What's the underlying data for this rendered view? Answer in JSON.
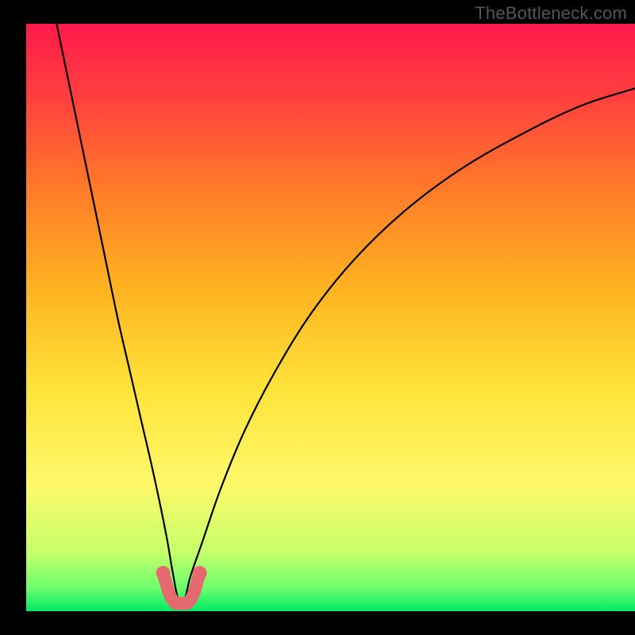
{
  "watermark": "TheBottleneck.com",
  "chart_data": {
    "type": "line",
    "title": "",
    "xlabel": "",
    "ylabel": "",
    "xlim": [
      0,
      100
    ],
    "ylim": [
      0,
      100
    ],
    "grid": false,
    "legend": false,
    "notes": "Bottleneck-percentage style curve with vertical rainbow gradient background (red top to green bottom). The black curve descends from top-left, reaches ~0 around x≈25, then rises toward upper-right. A short pink/salmon U-shaped overlay marks the minimum region.",
    "background_gradient_stops": [
      {
        "offset": 0.0,
        "color": "#ff1a4b"
      },
      {
        "offset": 0.12,
        "color": "#ff3e3e"
      },
      {
        "offset": 0.28,
        "color": "#ff7a2a"
      },
      {
        "offset": 0.45,
        "color": "#ffb321"
      },
      {
        "offset": 0.62,
        "color": "#ffe33a"
      },
      {
        "offset": 0.78,
        "color": "#fff86a"
      },
      {
        "offset": 0.9,
        "color": "#c6ff6a"
      },
      {
        "offset": 0.96,
        "color": "#6dff6d"
      },
      {
        "offset": 1.0,
        "color": "#00e865"
      }
    ],
    "series": [
      {
        "name": "bottleneck_curve",
        "color": "#000000",
        "x": [
          5,
          7,
          9,
          11,
          13,
          15,
          17,
          19,
          21,
          23,
          24,
          25,
          26,
          27,
          29,
          32,
          36,
          41,
          47,
          54,
          62,
          71,
          81,
          91,
          100
        ],
        "y": [
          100,
          90,
          80,
          70,
          60,
          50,
          41,
          32,
          23,
          13,
          7,
          2,
          2,
          6,
          12,
          21,
          31,
          41,
          51,
          60,
          68,
          75,
          81,
          86,
          89
        ]
      },
      {
        "name": "optimal_marker",
        "color": "#e46a6f",
        "x": [
          22.5,
          23.5,
          24.5,
          25.5,
          26.5,
          27.5,
          28.5
        ],
        "y": [
          6.5,
          3.0,
          1.4,
          1.4,
          1.4,
          3.0,
          6.5
        ]
      }
    ]
  }
}
